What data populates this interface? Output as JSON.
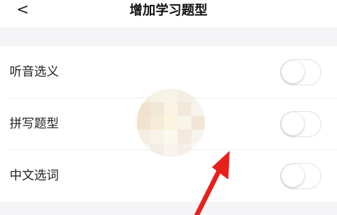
{
  "header": {
    "back_glyph": "<",
    "title": "增加学习题型"
  },
  "settings": {
    "items": [
      {
        "label": "听音选义",
        "enabled": false
      },
      {
        "label": "拼写题型",
        "enabled": false
      },
      {
        "label": "中文选词",
        "enabled": false
      }
    ]
  },
  "colors": {
    "page_background": "#f5f5f7",
    "row_background": "#ffffff",
    "toggle_border": "#dedede",
    "annotation_arrow": "#e8201c"
  },
  "icons": {
    "back": "chevron-left-icon",
    "annotation": "red-arrow-annotation"
  }
}
